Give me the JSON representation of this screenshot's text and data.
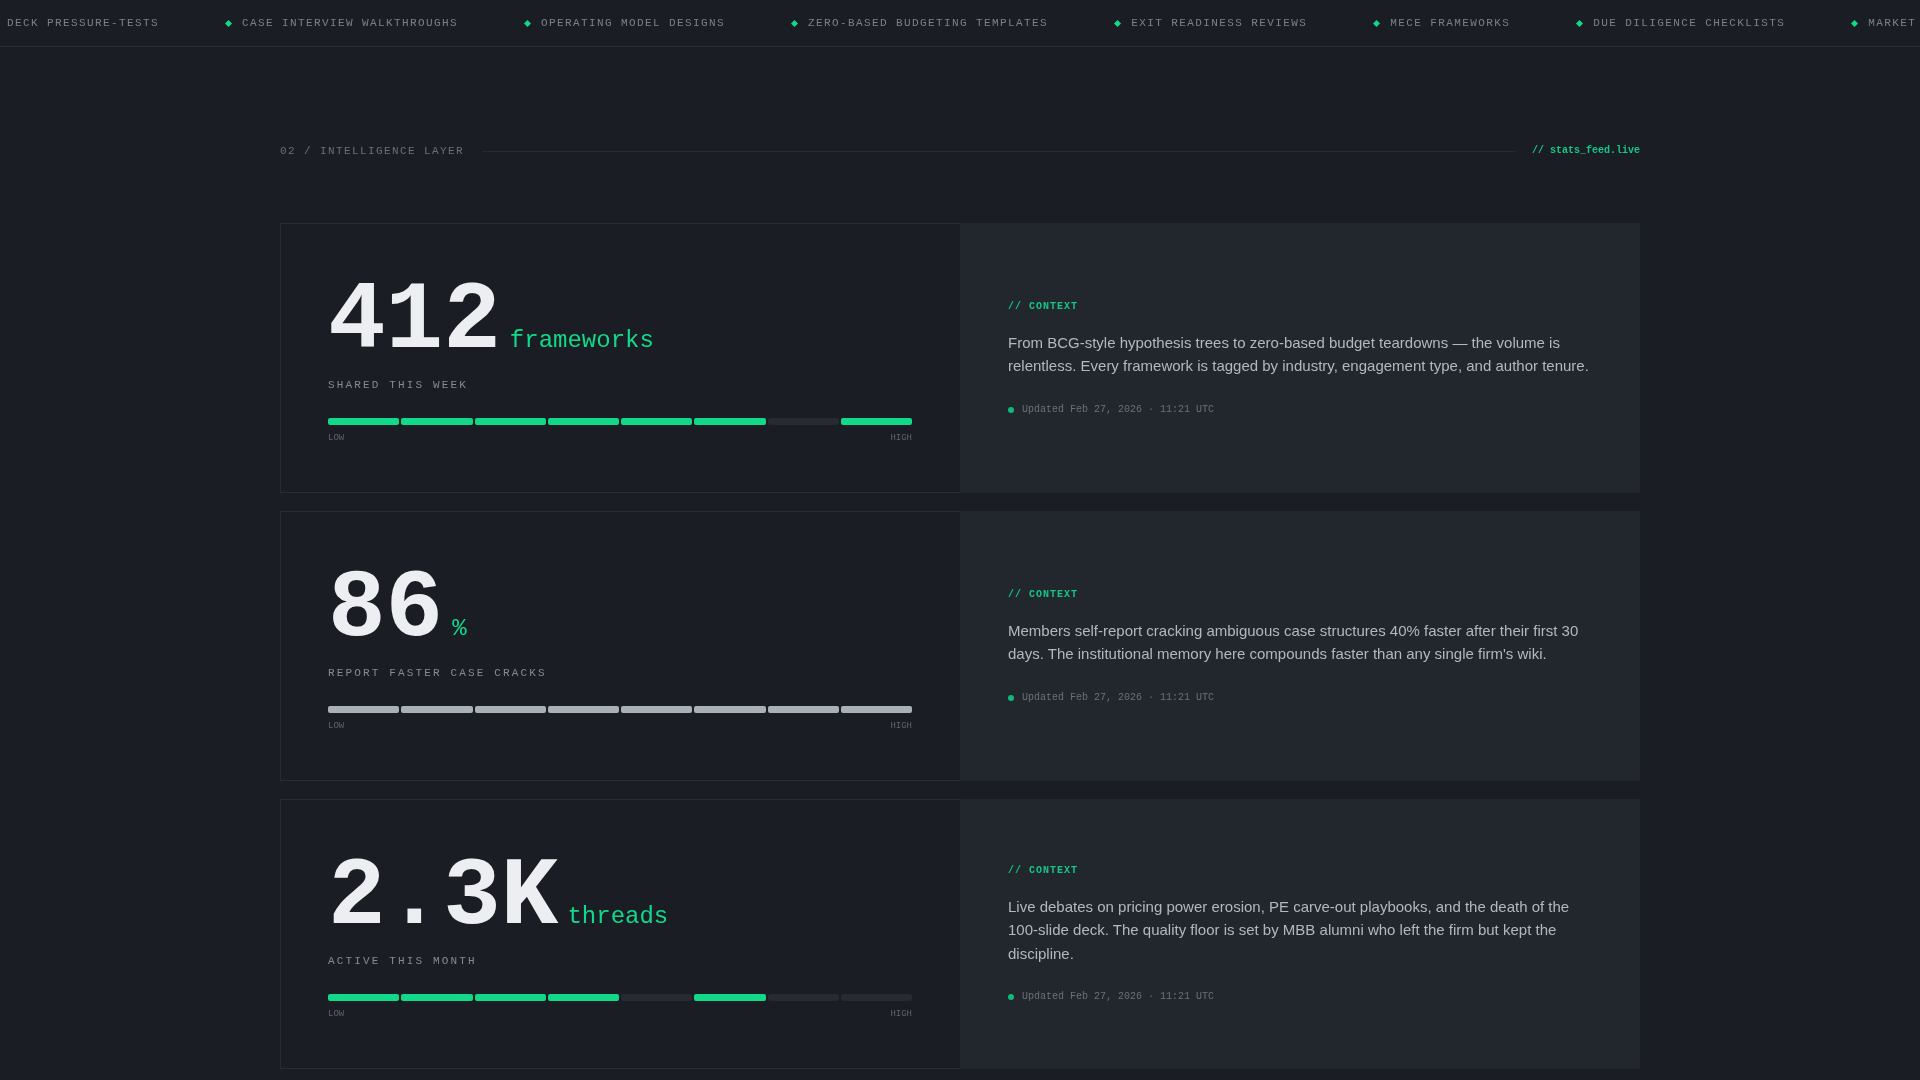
{
  "ticker": {
    "items": [
      "DECK PRESSURE-TESTS",
      "CASE INTERVIEW WALKTHROUGHS",
      "OPERATING MODEL DESIGNS",
      "ZERO-BASED BUDGETING TEMPLATES",
      "EXIT READINESS REVIEWS",
      "MECE FRAMEWORKS",
      "DUE DILIGENCE CHECKLISTS",
      "MARKET"
    ]
  },
  "section": {
    "label": "02 / INTELLIGENCE LAYER",
    "feed": "// stats_feed.live"
  },
  "stats": [
    {
      "value": "412",
      "unit": "frameworks",
      "caption": "SHARED THIS WEEK",
      "meter": {
        "color": "#12d98a",
        "segments": [
          {
            "on": true
          },
          {
            "on": true
          },
          {
            "on": true
          },
          {
            "on": true
          },
          {
            "on": true
          },
          {
            "on": true
          },
          {
            "on": false
          },
          {
            "on": true
          }
        ],
        "low": "LOW",
        "high": "HIGH"
      },
      "context": {
        "tag": "// CONTEXT",
        "text": "From BCG-style hypothesis trees to zero-based budget teardowns — the volume is relentless. Every framework is tagged by industry, engagement type, and author tenure.",
        "updated": "Updated Feb 27, 2026 · 11:21 UTC"
      }
    },
    {
      "value": "86",
      "unit": "%",
      "caption": "REPORT FASTER CASE CRACKS",
      "meter": {
        "color": "#a9b0b8",
        "segments": [
          {
            "on": true
          },
          {
            "on": true
          },
          {
            "on": true
          },
          {
            "on": true
          },
          {
            "on": true
          },
          {
            "on": true
          },
          {
            "on": true
          },
          {
            "on": true
          }
        ],
        "low": "LOW",
        "high": "HIGH"
      },
      "context": {
        "tag": "// CONTEXT",
        "text": "Members self-report cracking ambiguous case structures 40% faster after their first 30 days. The institutional memory here compounds faster than any single firm's wiki.",
        "updated": "Updated Feb 27, 2026 · 11:21 UTC"
      }
    },
    {
      "value": "2.3K",
      "unit": "threads",
      "caption": "ACTIVE THIS MONTH",
      "meter": {
        "color": "#12d98a",
        "segments": [
          {
            "on": true
          },
          {
            "on": true
          },
          {
            "on": true
          },
          {
            "on": true
          },
          {
            "on": false
          },
          {
            "on": true
          },
          {
            "on": false
          },
          {
            "on": false
          }
        ],
        "low": "LOW",
        "high": "HIGH"
      },
      "context": {
        "tag": "// CONTEXT",
        "text": "Live debates on pricing power erosion, PE carve-out playbooks, and the death of the 100-slide deck. The quality floor is set by MBB alumni who left the firm but kept the discipline.",
        "updated": "Updated Feb 27, 2026 · 11:21 UTC"
      }
    }
  ]
}
